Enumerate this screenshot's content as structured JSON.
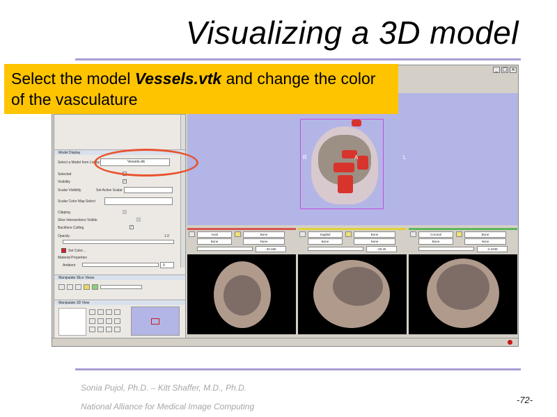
{
  "slide": {
    "title": "Visualizing a 3D model",
    "callout": {
      "before": "Select the model ",
      "emphasis": "Vessels.vtk",
      "after": " and change the color of the vasculature"
    },
    "footer_authors": "Sonia Pujol, Ph.D. – Kitt Shaffer, M.D., Ph.D.",
    "footer_org": "National Alliance for Medical Image Computing",
    "page_number": "-72-"
  },
  "app": {
    "window_buttons": [
      "_",
      "□",
      "×"
    ],
    "left_panel": {
      "model_display_header": "Model Display",
      "select_model_label": "Select a Model from List by",
      "select_model_value": "Vessels.vtk",
      "selected_label": "Selected",
      "visibility_label": "Visibility",
      "scalar_visibility_label": "Scalar Visibility",
      "set_active_scalar_label": "Set Active Scalar",
      "scalar_color_map_label": "Scalar Color Map Select",
      "clipping_label": "Clipping",
      "slice_intersections_label": "Slice Intersections Visible",
      "backface_culling_label": "Backface Culling",
      "opacity_label": "Opacity",
      "opacity_value": "1.0",
      "set_color_label": "Set Color...",
      "material_properties_label": "Material Properties",
      "ambient_label": "Ambient",
      "ambient_value": "0",
      "manipulate_slice_views": "Manipulate Slice Views",
      "manipulate_3d_view": "Manipulate 3D View"
    },
    "view3d": {
      "orient_r": "R",
      "orient_a": "A",
      "orient_l": "L"
    },
    "slice_controls": [
      {
        "id": "red",
        "color": "#d9534f",
        "orientation": "Axial",
        "fg": "Bone",
        "bg": "None",
        "label": "Bone",
        "value": "-30.465"
      },
      {
        "id": "yellow",
        "color": "#e0d23a",
        "orientation": "Sagittal",
        "fg": "Bone",
        "bg": "None",
        "label": "Bone",
        "value": "-29.25"
      },
      {
        "id": "green",
        "color": "#5bb85b",
        "orientation": "Coronal",
        "fg": "Bone",
        "bg": "None",
        "label": "Bone",
        "value": "-2.3438"
      }
    ],
    "colors": {
      "view3d_bg": "#b3b5e6",
      "callout_bg": "#ffc400",
      "oval": "#e8532f",
      "rule": "#a99cd6",
      "vessels": "#d6342c"
    }
  }
}
